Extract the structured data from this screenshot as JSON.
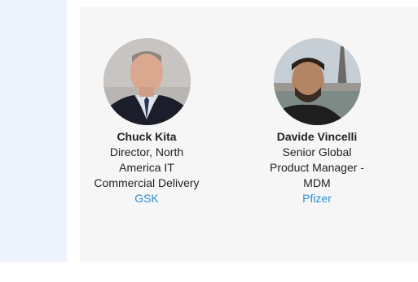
{
  "speakers": [
    {
      "name": "Chuck Kita",
      "title": "Director, North America IT Commercial Delivery",
      "title_lines": [
        "Director, North",
        "America IT",
        "Commercial Delivery"
      ],
      "company": "GSK"
    },
    {
      "name": "Davide Vincelli",
      "title": "Senior Global Product Manager - MDM",
      "title_lines": [
        "Senior Global",
        "Product Manager -",
        "MDM"
      ],
      "company": "Pfizer"
    }
  ],
  "colors": {
    "link": "#2b8fd6",
    "panel_left": "#eef4fc",
    "card_bg": "#f6f6f6"
  }
}
